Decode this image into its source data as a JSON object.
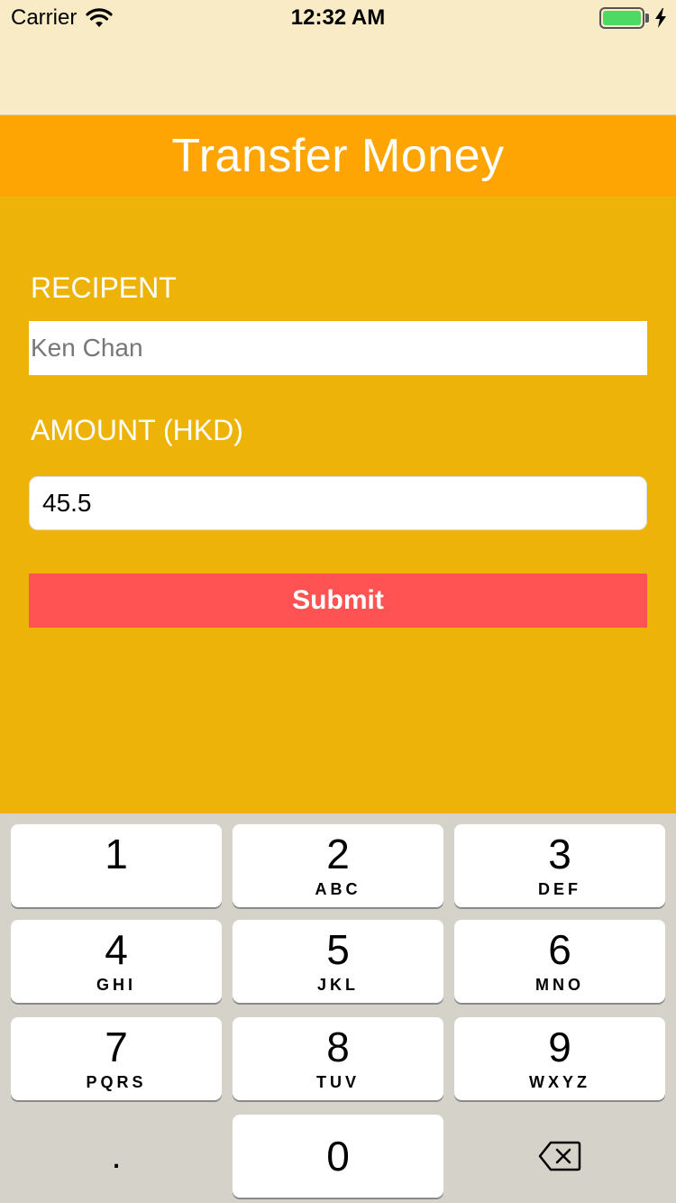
{
  "status_bar": {
    "carrier": "Carrier",
    "time": "12:32 AM",
    "battery_level": 1.0,
    "battery_color": "#4cd964"
  },
  "nav": {
    "title": "Transfer Money",
    "background": "#fea503"
  },
  "form": {
    "background": "#edb309",
    "recipient_label": "RECIPENT",
    "recipient_placeholder": "Ken Chan",
    "recipient_value": "",
    "amount_label": "AMOUNT (HKD)",
    "amount_value": "45.5",
    "submit_label": "Submit",
    "submit_color": "#ff5252"
  },
  "keypad": {
    "keys": [
      {
        "digit": "1",
        "letters": ""
      },
      {
        "digit": "2",
        "letters": "ABC"
      },
      {
        "digit": "3",
        "letters": "DEF"
      },
      {
        "digit": "4",
        "letters": "GHI"
      },
      {
        "digit": "5",
        "letters": "JKL"
      },
      {
        "digit": "6",
        "letters": "MNO"
      },
      {
        "digit": "7",
        "letters": "PQRS"
      },
      {
        "digit": "8",
        "letters": "TUV"
      },
      {
        "digit": "9",
        "letters": "WXYZ"
      },
      {
        "digit": "0",
        "letters": ""
      }
    ],
    "decimal_key": ".",
    "delete_icon": "delete-backspace-icon"
  }
}
